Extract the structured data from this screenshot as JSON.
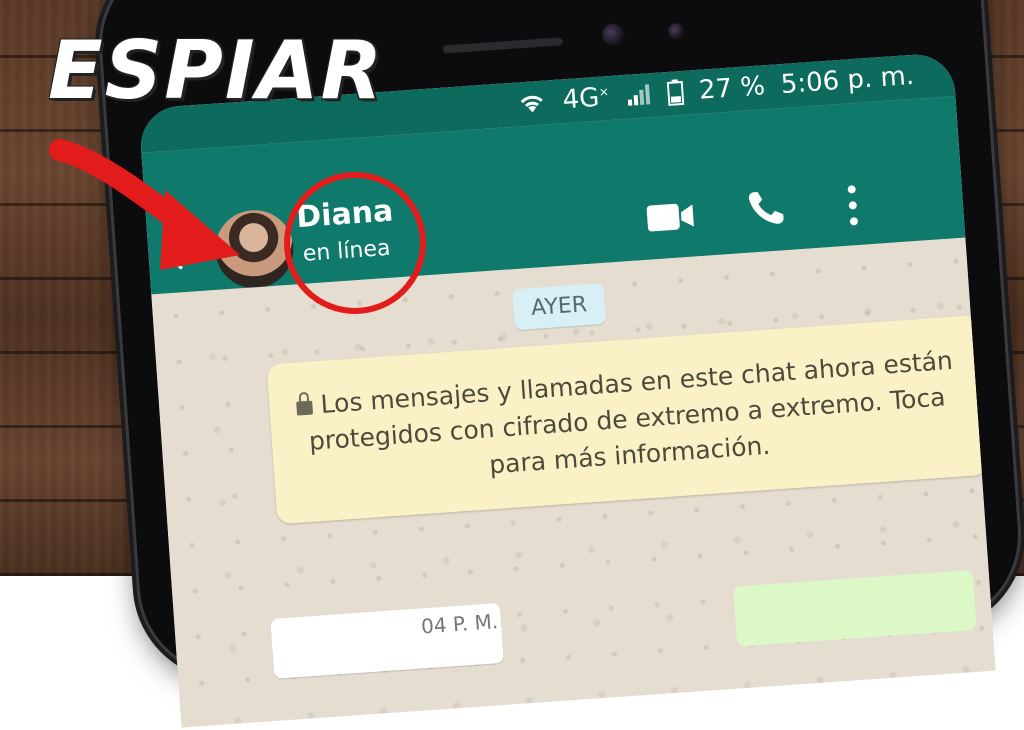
{
  "overlay": {
    "title": "ESPIAR"
  },
  "statusbar": {
    "network": "4G",
    "network_sup": "×",
    "battery": "27 %",
    "time": "5:06 p. m."
  },
  "header": {
    "contact_name": "Diana",
    "contact_status": "en línea"
  },
  "chat": {
    "date_chip": "AYER",
    "encryption_notice": "Los mensajes y llamadas en este chat ahora están protegidos con cifrado de extremo a extremo. Toca para más información.",
    "partial_message_time": "04 P. M."
  },
  "icons": [
    "arrow-left-icon",
    "video-call-icon",
    "phone-call-icon",
    "more-vertical-icon",
    "lock-icon",
    "wifi-icon",
    "battery-icon"
  ],
  "colors": {
    "header": "#0f7a6b",
    "statusbar": "#0d6b5e",
    "highlight": "#e21b1b",
    "notice_bg": "#fbf1c6",
    "date_chip_bg": "#d8eff6"
  }
}
